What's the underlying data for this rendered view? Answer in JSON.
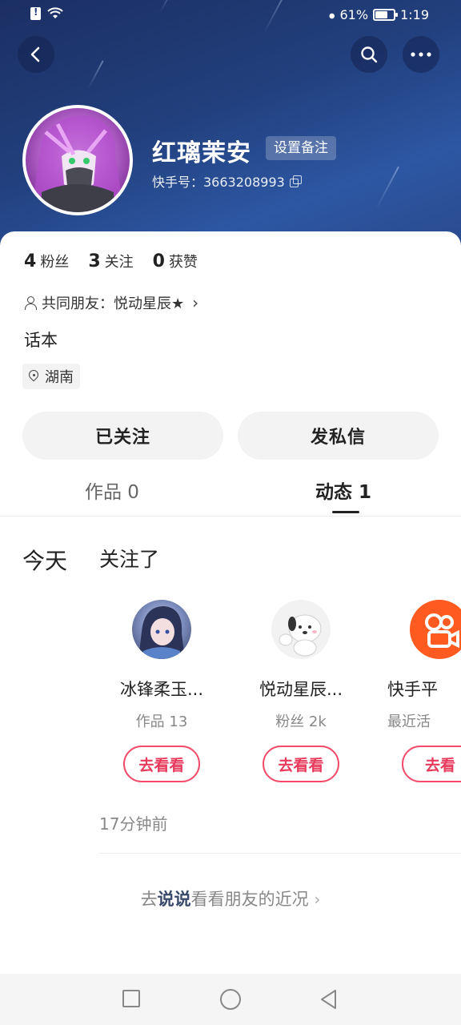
{
  "status_bar": {
    "battery_percent": "61%",
    "time": "1:19"
  },
  "header": {
    "icons": [
      "back-arrow-icon",
      "search-icon",
      "more-icon"
    ],
    "username": "红璃茉安",
    "remark_button": "设置备注",
    "kuaishou_id": "快手号：3663208993"
  },
  "profile": {
    "stats": [
      {
        "value": "4",
        "label": "粉丝"
      },
      {
        "value": "3",
        "label": "关注"
      },
      {
        "value": "0",
        "label": "获赞"
      }
    ],
    "mutual_friends": "共同朋友：悦动星辰★",
    "bio": "话本",
    "location": "湖南",
    "follow_button": "已关注",
    "message_button": "发私信"
  },
  "tabs": [
    {
      "label": "作品 0",
      "active": false
    },
    {
      "label": "动态 1",
      "active": true
    }
  ],
  "feed": {
    "day": "今天",
    "action": "关注了",
    "users": [
      {
        "name": "冰锋柔玉...",
        "sub": "作品 13",
        "button": "去看看"
      },
      {
        "name": "悦动星辰...",
        "sub": "粉丝 2k",
        "button": "去看看"
      },
      {
        "name": "快手平",
        "sub": "最近活",
        "button": "去看"
      }
    ],
    "time_ago": "17分钟前",
    "prompt_prefix": "去",
    "prompt_highlight": "说说",
    "prompt_suffix": "看看朋友的近况"
  },
  "colors": {
    "header_blue": "#22407e",
    "accent_pink": "#e83a5c",
    "kuaishou_orange": "#ff5a1f"
  }
}
